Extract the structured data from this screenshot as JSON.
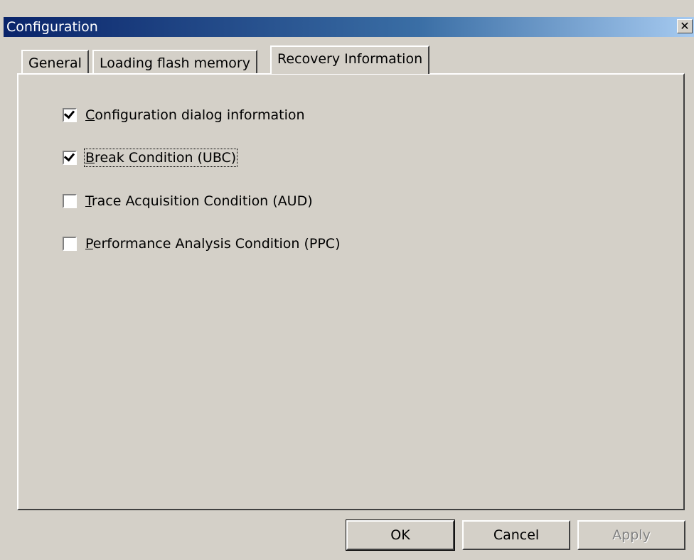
{
  "window": {
    "title": "Configuration",
    "close_glyph": "✕"
  },
  "tabs": [
    {
      "label": "General",
      "active": false
    },
    {
      "label": "Loading flash memory",
      "active": false
    },
    {
      "label": "Recovery Information",
      "active": true
    }
  ],
  "options": [
    {
      "label": "Configuration dialog information",
      "accelerator": "C",
      "checked": true
    },
    {
      "label": "Break Condition (UBC)",
      "accelerator": "B",
      "checked": true,
      "focused": true
    },
    {
      "label": "Trace Acquisition Condition (AUD)",
      "accelerator": "T",
      "checked": false
    },
    {
      "label": "Performance Analysis Condition (PPC)",
      "accelerator": "P",
      "checked": false
    }
  ],
  "buttons": {
    "ok": "OK",
    "cancel": "Cancel",
    "apply": "Apply"
  },
  "colors": {
    "title_gradient_start": "#0a246a",
    "title_gradient_end": "#a6caf0",
    "face": "#d4d0c8",
    "disabled_text": "#808080"
  }
}
